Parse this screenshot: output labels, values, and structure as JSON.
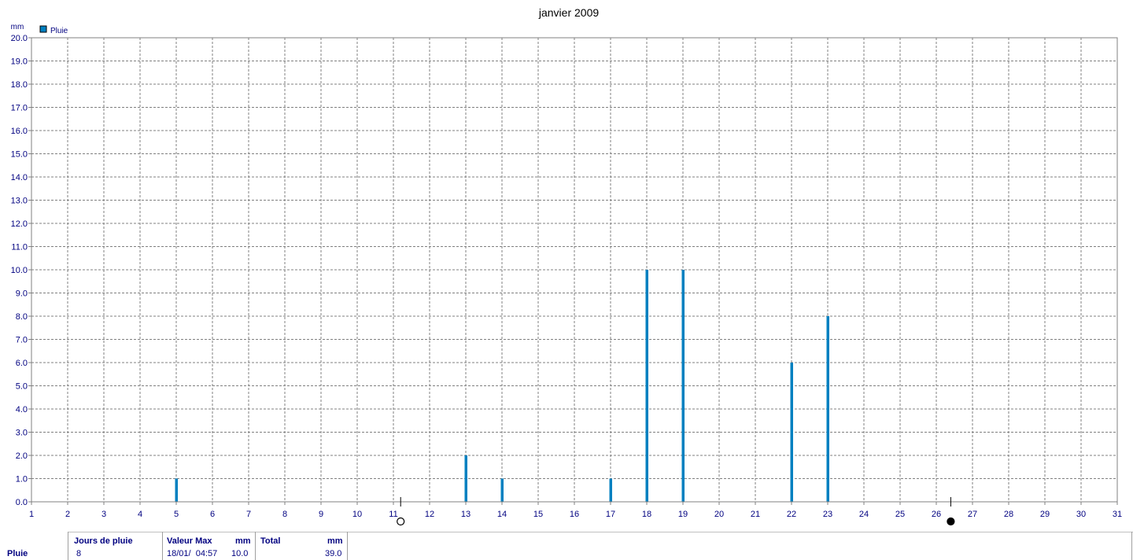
{
  "chart_data": {
    "type": "bar",
    "title": "janvier 2009",
    "ylabel": "mm",
    "legend": {
      "label": "Pluie",
      "color": "#0080c0",
      "position": "top-left"
    },
    "x": [
      1,
      2,
      3,
      4,
      5,
      6,
      7,
      8,
      9,
      10,
      11,
      12,
      13,
      14,
      15,
      16,
      17,
      18,
      19,
      20,
      21,
      22,
      23,
      24,
      25,
      26,
      27,
      28,
      29,
      30,
      31
    ],
    "xlim": [
      1,
      31
    ],
    "ylim": [
      0,
      20
    ],
    "y_ticks": [
      "0.0",
      "1.0",
      "2.0",
      "3.0",
      "4.0",
      "5.0",
      "6.0",
      "7.0",
      "8.0",
      "9.0",
      "10.0",
      "11.0",
      "12.0",
      "13.0",
      "14.0",
      "15.0",
      "16.0",
      "17.0",
      "18.0",
      "19.0",
      "20.0"
    ],
    "series": [
      {
        "name": "Pluie",
        "color": "#0080c0",
        "points": [
          {
            "x": 5,
            "y": 1.0
          },
          {
            "x": 13,
            "y": 2.0
          },
          {
            "x": 14,
            "y": 1.0
          },
          {
            "x": 17,
            "y": 1.0
          },
          {
            "x": 18,
            "y": 10.0
          },
          {
            "x": 19,
            "y": 10.0
          },
          {
            "x": 22,
            "y": 6.0
          },
          {
            "x": 23,
            "y": 8.0
          }
        ]
      }
    ],
    "grid": true,
    "moon_markers": [
      {
        "x": 11.2,
        "phase": "new"
      },
      {
        "x": 26.4,
        "phase": "full"
      }
    ]
  },
  "footer": {
    "row_label": "Pluie",
    "jours_label": "Jours de pluie",
    "jours_value": "8",
    "valmax_label": "Valeur Max",
    "valmax_unit": "mm",
    "valmax_date": "18/01/  04:57",
    "valmax_value": "10.0",
    "total_label": "Total",
    "total_unit": "mm",
    "total_value": "39.0"
  }
}
